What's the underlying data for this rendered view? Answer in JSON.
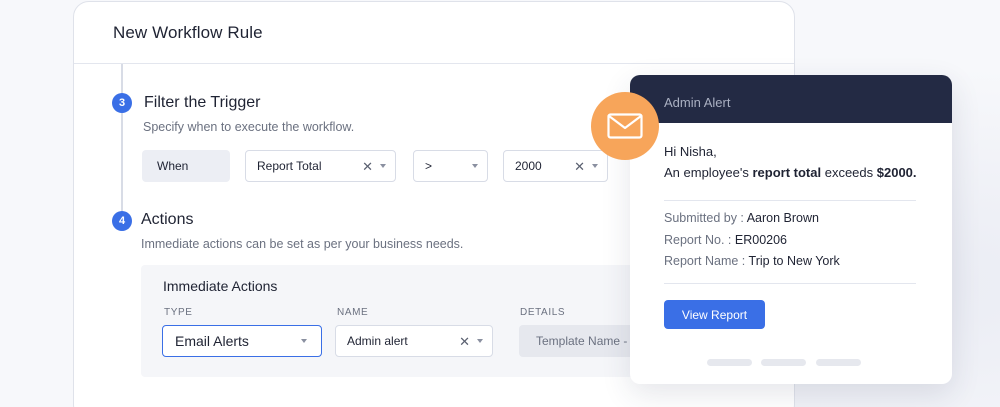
{
  "workflow": {
    "title": "New Workflow Rule",
    "trigger_step": {
      "number": "3",
      "title": "Filter the Trigger",
      "description": "Specify when to execute the workflow.",
      "when_label": "When",
      "field_value": "Report Total",
      "operator_value": ">",
      "amount_value": "2000"
    },
    "actions_step": {
      "number": "4",
      "title": "Actions",
      "description": "Immediate actions can be set as per your business needs."
    },
    "immediate_actions": {
      "title": "Immediate Actions",
      "col_type": "TYPE",
      "col_name": "NAME",
      "col_details": "DETAILS",
      "type_value": "Email Alerts",
      "name_value": "Admin alert",
      "details_value": "Template Name - D"
    }
  },
  "email_preview": {
    "header": "Admin Alert",
    "greeting": "Hi Nisha,",
    "alert_prefix": "An employee's ",
    "alert_bold1": "report total",
    "alert_middle": " exceeds ",
    "alert_bold2": "$2000.",
    "submitted_by_label": "Submitted by :",
    "submitted_by_value": "Aaron Brown",
    "report_no_label": "Report No. :",
    "report_no_value": "ER00206",
    "report_name_label": "Report Name :",
    "report_name_value": "Trip to New York",
    "button_label": "View Report"
  },
  "icons": {
    "clear": "✕",
    "mail": "mail-icon"
  },
  "colors": {
    "accent": "#3a6fe6",
    "header_dark": "#232a44",
    "mail_circle": "#f7a55a"
  }
}
